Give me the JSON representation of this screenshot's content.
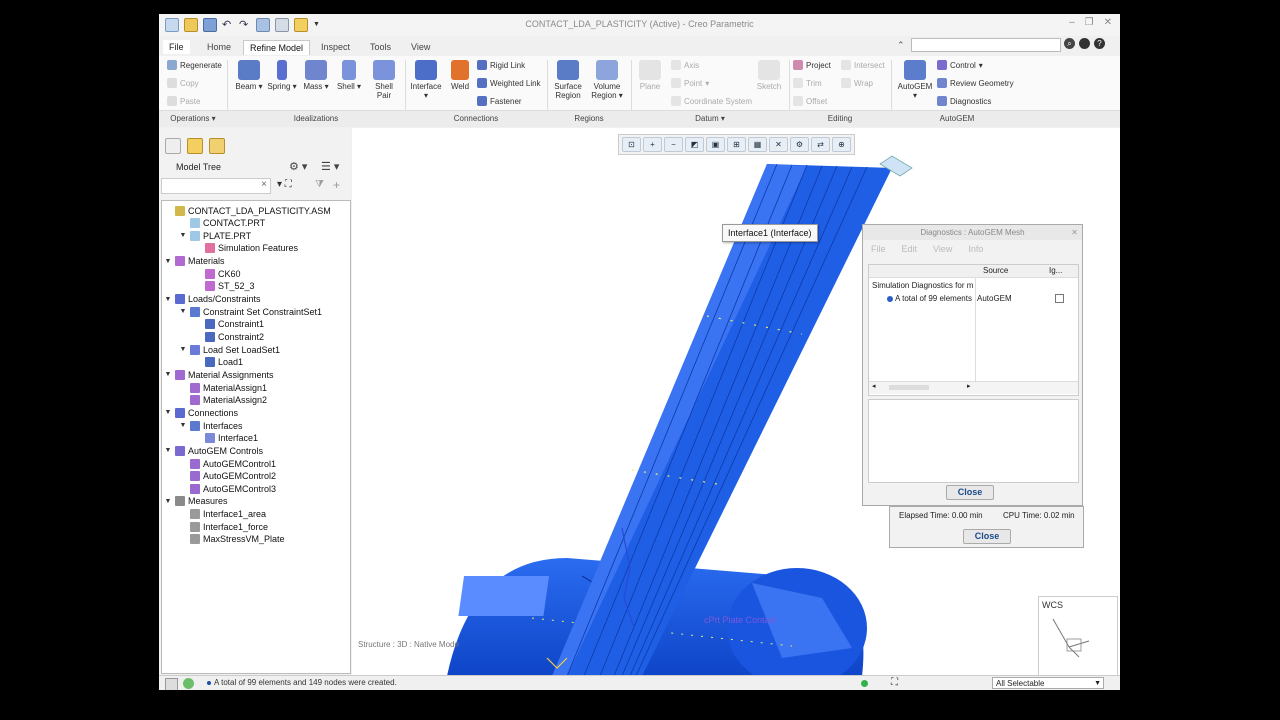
{
  "window": {
    "title": "CONTACT_LDA_PLASTICITY (Active) - Creo Parametric"
  },
  "menu": {
    "tabs": [
      "File",
      "Home",
      "Refine Model",
      "Inspect",
      "Tools",
      "View"
    ],
    "active_tab": "Refine Model"
  },
  "ribbon": {
    "operations": {
      "regenerate": "Regenerate",
      "copy": "Copy",
      "paste": "Paste",
      "label": "Operations"
    },
    "idealizations": {
      "beam": "Beam",
      "spring": "Spring",
      "mass": "Mass",
      "shell": "Shell",
      "shell_pair": "Shell\nPair",
      "label": "Idealizations"
    },
    "connections": {
      "interface": "Interface",
      "weld": "Weld",
      "rigid_link": "Rigid Link",
      "weighted_link": "Weighted Link",
      "fastener": "Fastener",
      "label": "Connections"
    },
    "regions": {
      "surface_region": "Surface\nRegion",
      "volume_region": "Volume\nRegion",
      "label": "Regions"
    },
    "datum": {
      "plane": "Plane",
      "axis": "Axis",
      "point": "Point",
      "coordinate_system": "Coordinate System",
      "sketch": "Sketch",
      "label": "Datum"
    },
    "editing": {
      "project": "Project",
      "intersect": "Intersect",
      "trim": "Trim",
      "wrap": "Wrap",
      "offset": "Offset",
      "label": "Editing"
    },
    "autogem": {
      "autogem": "AutoGEM",
      "control": "Control",
      "review_geometry": "Review Geometry",
      "diagnostics": "Diagnostics",
      "label": "AutoGEM"
    }
  },
  "model_tree": {
    "header": "Model Tree",
    "items": [
      {
        "label": "CONTACT_LDA_PLASTICITY.ASM",
        "level": 0,
        "toggle": "",
        "icon": "assembly-icon"
      },
      {
        "label": "CONTACT.PRT",
        "level": 1,
        "toggle": "",
        "icon": "part-icon"
      },
      {
        "label": "PLATE.PRT",
        "level": 1,
        "toggle": "▼",
        "icon": "part-icon"
      },
      {
        "label": "Simulation Features",
        "level": 2,
        "toggle": "",
        "icon": "simulation-icon"
      },
      {
        "label": "Materials",
        "level": 0,
        "toggle": "▼",
        "icon": "materials-icon"
      },
      {
        "label": "CK60",
        "level": 2,
        "toggle": "",
        "icon": "material-icon"
      },
      {
        "label": "ST_52_3",
        "level": 2,
        "toggle": "",
        "icon": "material-icon"
      },
      {
        "label": "Loads/Constraints",
        "level": 0,
        "toggle": "▼",
        "icon": "loads-icon"
      },
      {
        "label": "Constraint Set ConstraintSet1",
        "level": 1,
        "toggle": "▼",
        "icon": "constraint-set-icon"
      },
      {
        "label": "Constraint1",
        "level": 2,
        "toggle": "",
        "icon": "constraint-icon"
      },
      {
        "label": "Constraint2",
        "level": 2,
        "toggle": "",
        "icon": "constraint-icon"
      },
      {
        "label": "Load Set LoadSet1",
        "level": 1,
        "toggle": "▼",
        "icon": "load-set-icon"
      },
      {
        "label": "Load1",
        "level": 2,
        "toggle": "",
        "icon": "load-icon"
      },
      {
        "label": "Material Assignments",
        "level": 0,
        "toggle": "▼",
        "icon": "material-assign-icon"
      },
      {
        "label": "MaterialAssign1",
        "level": 1,
        "toggle": "",
        "icon": "material-assign-icon"
      },
      {
        "label": "MaterialAssign2",
        "level": 1,
        "toggle": "",
        "icon": "material-assign-icon"
      },
      {
        "label": "Connections",
        "level": 0,
        "toggle": "▼",
        "icon": "connections-icon"
      },
      {
        "label": "Interfaces",
        "level": 1,
        "toggle": "▼",
        "icon": "interfaces-icon"
      },
      {
        "label": "Interface1",
        "level": 2,
        "toggle": "",
        "icon": "interface-icon"
      },
      {
        "label": "AutoGEM Controls",
        "level": 0,
        "toggle": "▼",
        "icon": "autogem-icon"
      },
      {
        "label": "AutoGEMControl1",
        "level": 1,
        "toggle": "",
        "icon": "autogem-control-icon"
      },
      {
        "label": "AutoGEMControl2",
        "level": 1,
        "toggle": "",
        "icon": "autogem-control-icon"
      },
      {
        "label": "AutoGEMControl3",
        "level": 1,
        "toggle": "",
        "icon": "autogem-control-icon"
      },
      {
        "label": "Measures",
        "level": 0,
        "toggle": "▼",
        "icon": "measures-icon"
      },
      {
        "label": "Interface1_area",
        "level": 1,
        "toggle": "",
        "icon": "measure-icon"
      },
      {
        "label": "Interface1_force",
        "level": 1,
        "toggle": "",
        "icon": "measure-icon"
      },
      {
        "label": "MaxStressVM_Plate",
        "level": 1,
        "toggle": "",
        "icon": "measure-icon"
      }
    ]
  },
  "viewport": {
    "tooltip": "Interface1 (Interface)",
    "wcs_label": "WCS",
    "structure_note": "Structure : 3D : Native Mode"
  },
  "diagnostics": {
    "title": "Diagnostics : AutoGEM Mesh",
    "menu": [
      "File",
      "Edit",
      "View",
      "Info"
    ],
    "columns": [
      "Source",
      "Ig..."
    ],
    "root": "Simulation Diagnostics for m",
    "row_text": "A total of 99 elements",
    "row_source": "AutoGEM",
    "close_label": "Close"
  },
  "timing": {
    "elapsed": "Elapsed Time:  0.00 min",
    "cpu": "CPU Time:  0.02 min",
    "close_label": "Close"
  },
  "status": {
    "message": "A total of 99 elements and 149 nodes were created.",
    "selection_filter": "All Selectable"
  },
  "colors": {
    "model_blue": "#1f5fe6",
    "model_blue_light": "#4a86ff",
    "link_blue": "#1a4a8a"
  }
}
